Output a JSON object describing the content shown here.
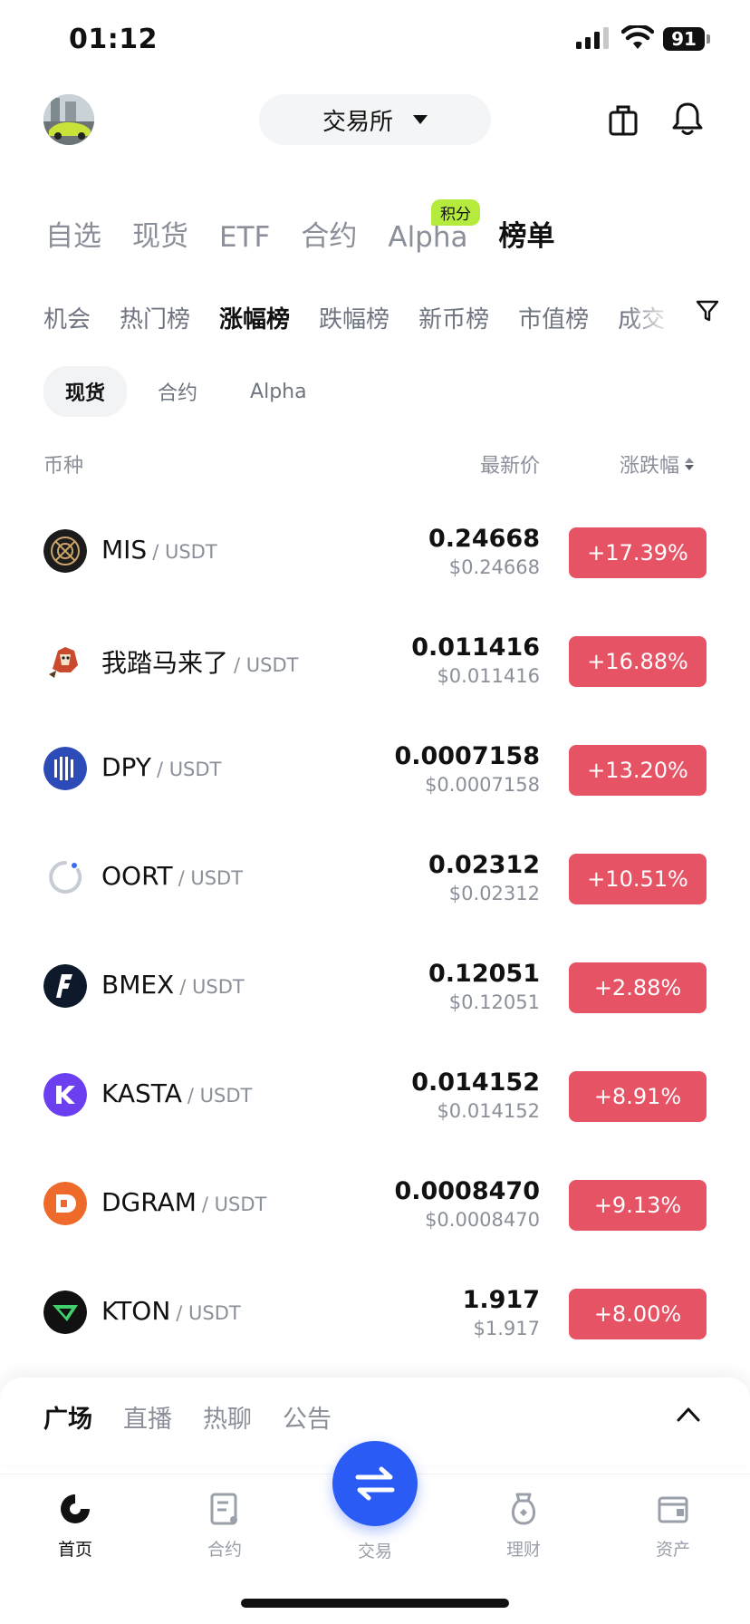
{
  "status_bar": {
    "time": "01:12",
    "battery": "91"
  },
  "header": {
    "exchange_label": "交易所"
  },
  "main_tabs": [
    {
      "label": "自选",
      "active": false
    },
    {
      "label": "现货",
      "active": false
    },
    {
      "label": "ETF",
      "active": false
    },
    {
      "label": "合约",
      "active": false
    },
    {
      "label": "Alpha",
      "active": false
    },
    {
      "label": "榜单",
      "active": true
    }
  ],
  "alpha_badge": "积分",
  "sub_tabs": [
    {
      "label": "机会",
      "active": false
    },
    {
      "label": "热门榜",
      "active": false
    },
    {
      "label": "涨幅榜",
      "active": true
    },
    {
      "label": "跌幅榜",
      "active": false
    },
    {
      "label": "新币榜",
      "active": false
    },
    {
      "label": "市值榜",
      "active": false
    },
    {
      "label": "成交",
      "active": false
    }
  ],
  "segments": [
    {
      "label": "现货",
      "active": true
    },
    {
      "label": "合约",
      "active": false
    },
    {
      "label": "Alpha",
      "active": false
    }
  ],
  "columns": {
    "coin": "币种",
    "price": "最新价",
    "change": "涨跌幅"
  },
  "coins": [
    {
      "symbol": "MIS",
      "quote": "/ USDT",
      "price": "0.24668",
      "usd": "$0.24668",
      "change": "+17.39%",
      "logo": "mis-logo"
    },
    {
      "symbol": "我踏马来了",
      "quote": "/ USDT",
      "price": "0.011416",
      "usd": "$0.011416",
      "change": "+16.88%",
      "logo": "horse-logo"
    },
    {
      "symbol": "DPY",
      "quote": "/ USDT",
      "price": "0.0007158",
      "usd": "$0.0007158",
      "change": "+13.20%",
      "logo": "dpy-logo"
    },
    {
      "symbol": "OORT",
      "quote": "/ USDT",
      "price": "0.02312",
      "usd": "$0.02312",
      "change": "+10.51%",
      "logo": "oort-logo"
    },
    {
      "symbol": "BMEX",
      "quote": "/ USDT",
      "price": "0.12051",
      "usd": "$0.12051",
      "change": "+2.88%",
      "logo": "bmex-logo"
    },
    {
      "symbol": "KASTA",
      "quote": "/ USDT",
      "price": "0.014152",
      "usd": "$0.014152",
      "change": "+8.91%",
      "logo": "kasta-logo"
    },
    {
      "symbol": "DGRAM",
      "quote": "/ USDT",
      "price": "0.0008470",
      "usd": "$0.0008470",
      "change": "+9.13%",
      "logo": "dgram-logo"
    },
    {
      "symbol": "KTON",
      "quote": "/ USDT",
      "price": "1.917",
      "usd": "$1.917",
      "change": "+8.00%",
      "logo": "kton-logo"
    }
  ],
  "feed_tabs": [
    {
      "label": "广场",
      "active": true
    },
    {
      "label": "直播",
      "active": false
    },
    {
      "label": "热聊",
      "active": false
    },
    {
      "label": "公告",
      "active": false
    }
  ],
  "bottom_nav": {
    "home": "首页",
    "futures": "合约",
    "trade": "交易",
    "earn": "理财",
    "assets": "资产"
  },
  "colors": {
    "up": "#e65365",
    "trade_fab": "#2a5bf5",
    "alpha_badge": "#b5eb3d"
  }
}
